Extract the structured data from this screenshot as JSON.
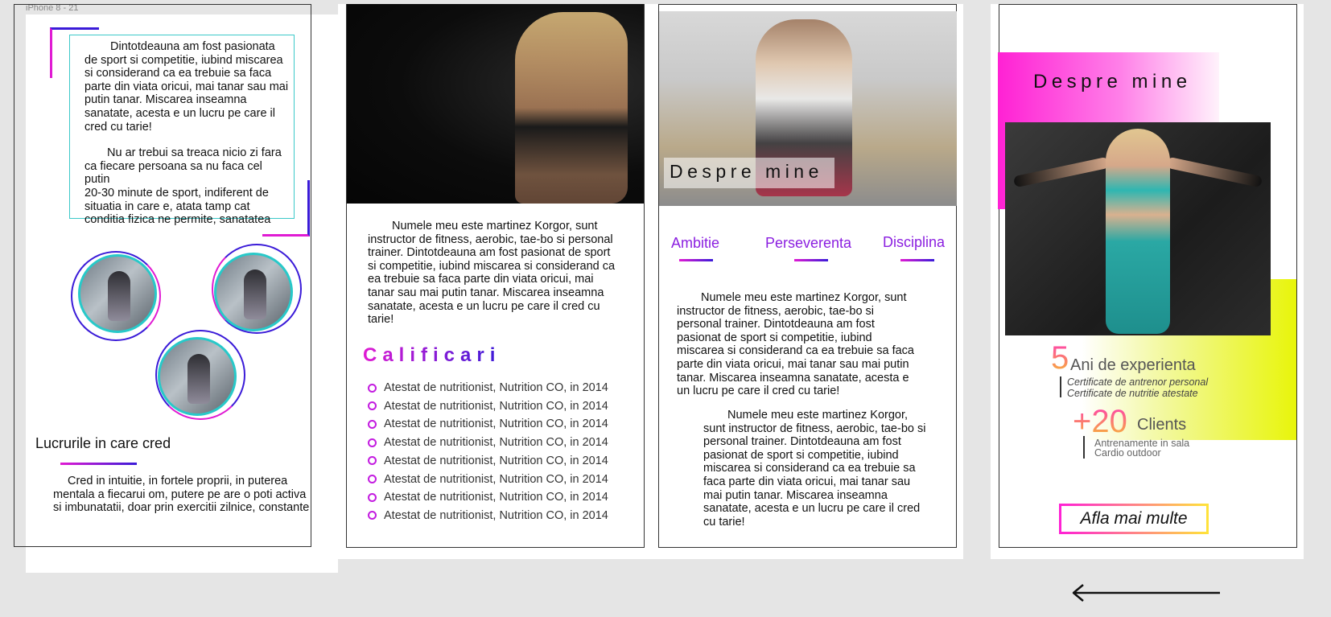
{
  "frame": {
    "label": "iPhone 8 - 21"
  },
  "screen1": {
    "paragraph1": "Dintotdeauna am fost pasionata\nde sport si competitie, iubind miscarea\nsi considerand ca ea trebuie sa faca\nparte din viata oricui, mai tanar sau mai\nputin tanar. Miscarea inseamna\nsanatate, acesta e un lucru pe care il\ncred cu tarie!",
    "paragraph2": "Nu ar trebui sa treaca nicio zi fara\nca fiecare persoana sa nu faca cel putin\n20-30 minute de sport, indiferent de\nsituatia in care e, atata tamp cat\nconditia fizica ne permite, sanatatea",
    "heading": "Lucrurile in care cred",
    "belief_text": "Cred in intuitie,  in fortele proprii, in puterea\nmentala a fiecarui om, putere pe are o poti activa\nsi imbunatatii, doar prin exercitii zilnice, constante"
  },
  "screen2": {
    "intro": "Numele meu este martinez Korgor, sunt\ninstructor de fitness, aerobic, tae-bo si  personal\ntrainer. Dintotdeauna am fost pasionat de sport\nsi competitie, iubind miscarea si considerand ca\nea trebuie sa faca parte din viata oricui, mai\ntanar sau mai putin tanar. Miscarea inseamna\nsanatate, acesta e un lucru pe care il cred cu\ntarie!",
    "qualifications_title": "Calificari",
    "qualifications": [
      "Atestat de nutritionist, Nutrition CO,  in 2014",
      "Atestat de nutritionist, Nutrition CO,  in 2014",
      "Atestat de nutritionist, Nutrition CO,  in 2014",
      "Atestat de nutritionist, Nutrition CO,  in 2014",
      "Atestat de nutritionist, Nutrition CO,  in 2014",
      "Atestat de nutritionist, Nutrition CO,  in 2014",
      "Atestat de nutritionist, Nutrition CO,  in 2014",
      "Atestat de nutritionist, Nutrition CO,  in 2014"
    ]
  },
  "screen3": {
    "hero_title": "Despre mine",
    "values": [
      "Ambitie",
      "Perseverenta",
      "Disciplina"
    ],
    "paragraph1": "Numele meu este martinez Korgor, sunt\ninstructor de fitness, aerobic, tae-bo si\npersonal trainer. Dintotdeauna am fost\npasionat de sport si competitie, iubind\nmiscarea si considerand ca ea trebuie sa faca\nparte din viata oricui, mai tanar sau mai putin\ntanar. Miscarea inseamna sanatate, acesta e\nun lucru pe care il cred cu tarie!",
    "paragraph2": "Numele meu este martinez Korgor,\nsunt instructor de fitness, aerobic, tae-bo si\npersonal trainer. Dintotdeauna am fost\npasionat de sport si competitie, iubind\nmiscarea si considerand ca ea trebuie sa\nfaca parte din viata oricui, mai tanar sau\nmai putin tanar. Miscarea inseamna\nsanatate, acesta e un lucru pe care il cred\ncu tarie!"
  },
  "screen4": {
    "title": "Despre mine",
    "stat1": {
      "number": "5",
      "label": "Ani de experienta",
      "details": [
        "Certificate de antrenor personal",
        "Certificate de nutritie atestate"
      ]
    },
    "stat2": {
      "number": "+20",
      "label": "Clients",
      "details": [
        "Antrenamente in sala",
        "Cardio outdoor"
      ]
    },
    "cta": "Afla mai multe"
  },
  "colors": {
    "pink": "#e01bd3",
    "blue": "#3a1bd8",
    "teal": "#28c9c9",
    "purple": "#8b1fe0",
    "yellow": "#e8f50a"
  },
  "icons": {
    "back": "arrow-left-icon",
    "bullet": "circle-bullet-icon"
  }
}
